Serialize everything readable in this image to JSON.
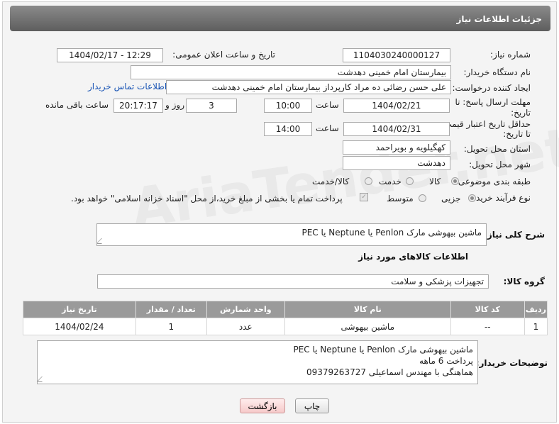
{
  "header": {
    "title": "جزئیات اطلاعات نیاز"
  },
  "fields": {
    "need_number_label": "شماره نیاز:",
    "need_number": "1104030240000127",
    "announce_label": "تاریخ و ساعت اعلان عمومی:",
    "announce_value": "1404/02/17 - 12:29",
    "buyer_org_label": "نام دستگاه خریدار:",
    "buyer_org": "بیمارستان امام خمینی دهدشت",
    "requester_label": "ایجاد کننده درخواست:",
    "requester": "علی حسن رضائی ده مراد کارپرداز بیمارستان امام خمینی دهدشت",
    "contact_link": "اطلاعات تماس خریدار",
    "deadline_label_1": "مهلت ارسال پاسخ: تا",
    "deadline_label_2": "تاریخ:",
    "deadline_date": "1404/02/21",
    "time_label": "ساعت",
    "deadline_time": "10:00",
    "days_value": "3",
    "days_label": "روز و",
    "remaining_time": "20:17:17",
    "remaining_label": "ساعت باقی مانده",
    "validity_label_1": "حداقل تاریخ اعتبار قیمت:",
    "validity_label_2": "تا تاریخ:",
    "validity_date": "1404/02/31",
    "validity_time": "14:00",
    "province_label": "استان محل تحویل:",
    "province": "کهگیلویه و بویراحمد",
    "city_label": "شهر محل تحویل:",
    "city": "دهدشت",
    "category_label": "طبقه بندی موضوعی:",
    "category_options": [
      "کالا",
      "خدمت",
      "کالا/خدمت"
    ],
    "category_selected": "کالا",
    "process_label": "نوع فرآیند خرید :",
    "process_options": [
      "جزیی",
      "متوسط"
    ],
    "process_selected": "جزیی",
    "payment_note": "پرداخت تمام یا بخشی از مبلغ خرید،از محل \"اسناد خزانه اسلامی\" خواهد بود."
  },
  "description": {
    "label": "شرح کلی نیاز:",
    "value": "ماشین بیهوشی مارک Penlon  یا  Neptune یا PEC"
  },
  "goods_section": {
    "title": "اطلاعات کالاهای مورد نیاز",
    "group_label": "گروه کالا:",
    "group_value": "تجهیزات پزشکی و سلامت"
  },
  "table": {
    "headers": [
      "ردیف",
      "کد کالا",
      "نام کالا",
      "واحد شمارش",
      "تعداد / مقدار",
      "تاریخ نیاز"
    ],
    "rows": [
      [
        "1",
        "--",
        "ماشین بیهوشی",
        "عدد",
        "1",
        "1404/02/24"
      ]
    ]
  },
  "buyer_notes": {
    "label": "توضیحات خریدار:",
    "lines": [
      "ماشین بیهوشی مارک Penlon  یا  Neptune یا PEC",
      "پرداخت 6 ماهه",
      "هماهنگی با مهندس اسماعیلی 09379263727"
    ]
  },
  "buttons": {
    "print": "چاپ",
    "back": "بازگشت"
  },
  "watermark_text": "AriaTender.net"
}
